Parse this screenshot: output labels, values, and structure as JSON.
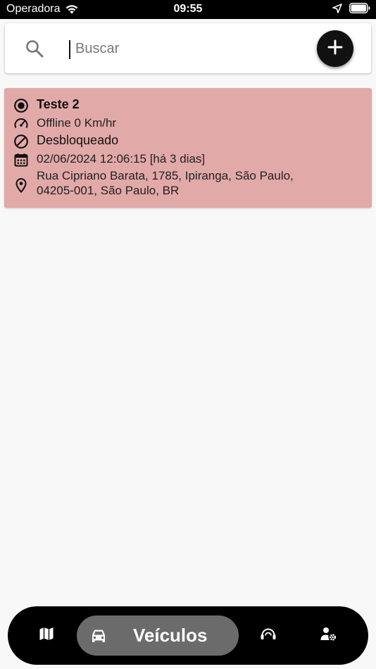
{
  "status_bar": {
    "carrier": "Operadora",
    "time": "09:55",
    "icons": [
      "wifi-icon",
      "location-arrow-icon",
      "battery-icon"
    ]
  },
  "search": {
    "placeholder": "Buscar",
    "value": "",
    "icons": [
      "search-icon",
      "add-icon"
    ]
  },
  "vehicles": [
    {
      "name": "Teste 2",
      "speed_status": "Offline 0 Km/hr",
      "lock_status": "Desbloqueado",
      "datetime": "02/06/2024 12:06:15 [há 3 dias]",
      "address_line1": "Rua Cipriano Barata, 1785, Ipiranga, São Paulo,",
      "address_line2": "04205-001, São Paulo, BR",
      "card_color": "#e2a9a9"
    }
  ],
  "bottom_nav": {
    "items": [
      {
        "icon": "map-icon"
      },
      {
        "icon": "car-icon",
        "label": "Veículos",
        "active": true
      },
      {
        "icon": "support-agent-icon"
      },
      {
        "icon": "user-settings-icon"
      }
    ]
  }
}
